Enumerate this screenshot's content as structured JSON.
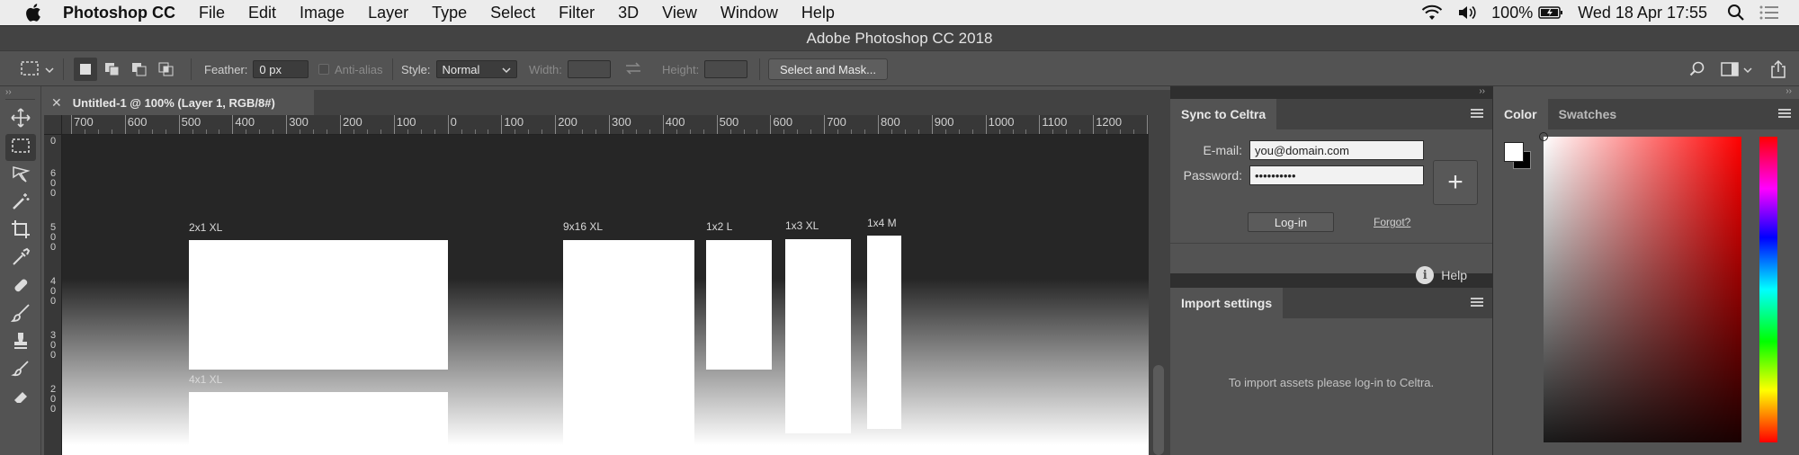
{
  "menubar": {
    "app": "Photoshop CC",
    "items": [
      "File",
      "Edit",
      "Image",
      "Layer",
      "Type",
      "Select",
      "Filter",
      "3D",
      "View",
      "Window",
      "Help"
    ],
    "battery": "100%",
    "clock": "Wed 18 Apr  17:55"
  },
  "window": {
    "title": "Adobe Photoshop CC 2018"
  },
  "options": {
    "feather_label": "Feather:",
    "feather_value": "0 px",
    "antialias_label": "Anti-alias",
    "style_label": "Style:",
    "style_value": "Normal",
    "width_label": "Width:",
    "height_label": "Height:",
    "select_mask": "Select and Mask..."
  },
  "document": {
    "tab_title": "Untitled-1 @ 100% (Layer 1, RGB/8#)",
    "ruler_h": [
      "700",
      "600",
      "500",
      "400",
      "300",
      "200",
      "100",
      "0",
      "100",
      "200",
      "300",
      "400",
      "500",
      "600",
      "700",
      "800",
      "900",
      "1000",
      "1100",
      "1200",
      "1"
    ],
    "ruler_v": [
      "0",
      "600",
      "500",
      "400",
      "300",
      "200"
    ],
    "frames": [
      {
        "label": "2x1 XL"
      },
      {
        "label": "4x1 XL"
      },
      {
        "label": "9x16 XL"
      },
      {
        "label": "1x2 L"
      },
      {
        "label": "1x3 XL"
      },
      {
        "label": "1x4 M"
      }
    ]
  },
  "sync_panel": {
    "tab": "Sync to Celtra",
    "email_label": "E-mail:",
    "email_value": "you@domain.com",
    "password_label": "Password:",
    "password_value": "••••••••••",
    "login": "Log-in",
    "forgot": "Forgot?",
    "help": "Help"
  },
  "import_panel": {
    "tab": "Import settings",
    "message": "To import assets please log-in to Celtra."
  },
  "color_panel": {
    "tabs": [
      "Color",
      "Swatches"
    ],
    "foreground": "#ffffff",
    "background": "#000000"
  }
}
